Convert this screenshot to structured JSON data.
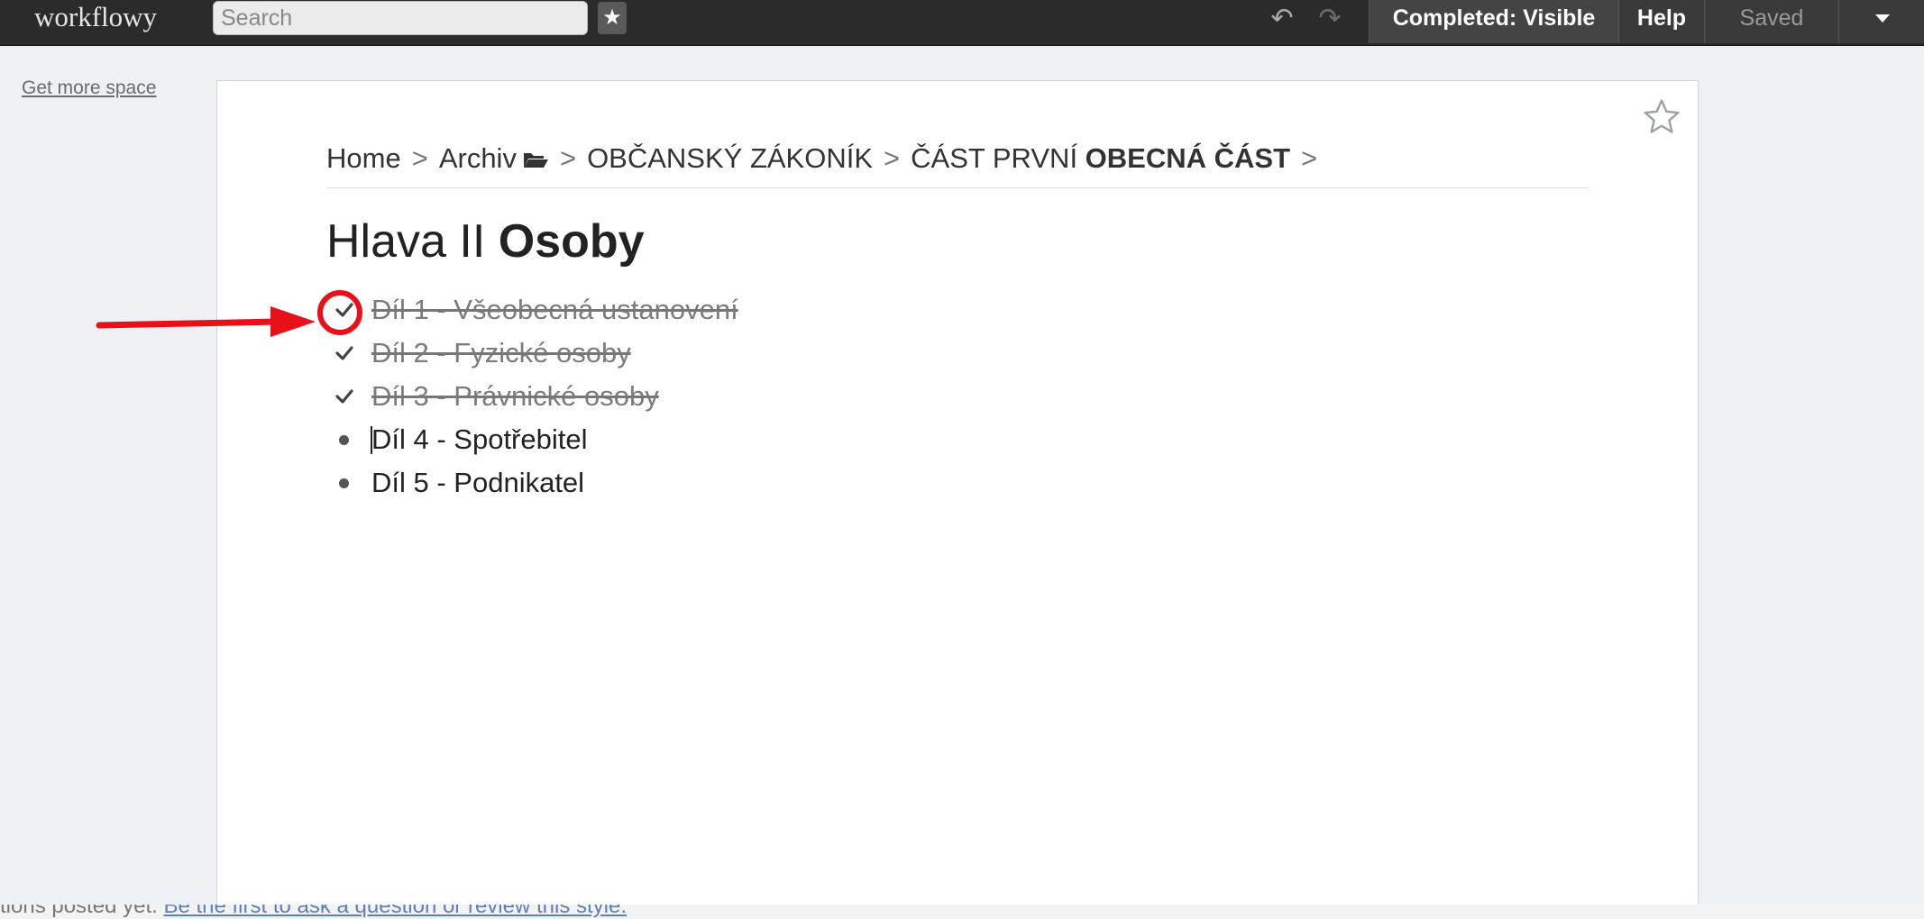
{
  "topbar": {
    "logo": "workflowy",
    "search_placeholder": "Search",
    "completed_label": "Completed: Visible",
    "help_label": "Help",
    "saved_label": "Saved"
  },
  "sidebar": {
    "get_more_space": "Get more space"
  },
  "breadcrumb": {
    "items": [
      {
        "label": "Home"
      },
      {
        "label": "Archiv"
      },
      {
        "label": "OBČANSKÝ ZÁKONÍK"
      },
      {
        "label_normal": "ČÁST PRVNÍ ",
        "label_bold": "OBECNÁ ČÁST"
      }
    ],
    "separator": ">"
  },
  "page": {
    "title_normal": "Hlava II ",
    "title_bold": "Osoby"
  },
  "items": [
    {
      "text": "Díl 1 - Všeobecná ustanovení",
      "completed": true
    },
    {
      "text": "Díl 2 - Fyzické osoby",
      "completed": true
    },
    {
      "text": "Díl 3 - Právnické osoby",
      "completed": true
    },
    {
      "text": "Díl 4 - Spotřebitel",
      "completed": false
    },
    {
      "text": "Díl 5 - Podnikatel",
      "completed": false
    }
  ],
  "footer": {
    "partial_text": "tions posted yet.",
    "link_text": "Be the first to ask a question or review this style."
  },
  "colors": {
    "annotation": "#e8111a",
    "topbar": "#2b2b2b"
  }
}
